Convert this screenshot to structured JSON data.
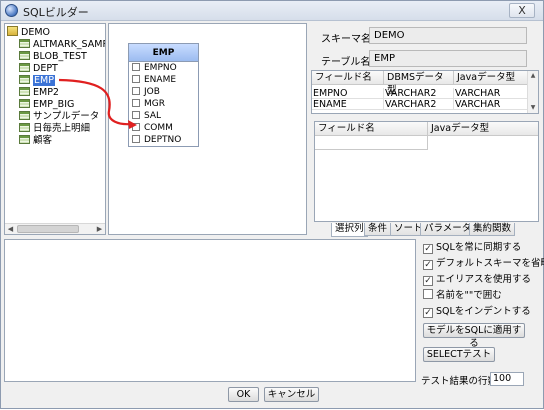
{
  "window": {
    "title": "SQLビルダー",
    "close_label": "X"
  },
  "tree": {
    "root": "DEMO",
    "items": [
      {
        "label": "ALTMARK_SAMPL"
      },
      {
        "label": "BLOB_TEST"
      },
      {
        "label": "DEPT"
      },
      {
        "label": "EMP",
        "selected": true
      },
      {
        "label": "EMP2"
      },
      {
        "label": "EMP_BIG"
      },
      {
        "label": "サンプルデータ"
      },
      {
        "label": "日毎売上明細"
      },
      {
        "label": "顧客"
      }
    ]
  },
  "diagram": {
    "entity": {
      "name": "EMP",
      "fields": [
        "EMPNO",
        "ENAME",
        "JOB",
        "MGR",
        "SAL",
        "COMM",
        "DEPTNO"
      ]
    }
  },
  "info": {
    "schema_label": "スキーマ名",
    "schema_value": "DEMO",
    "table_label": "テーブル名",
    "table_value": "EMP"
  },
  "field_grid": {
    "headers": [
      "フィールド名",
      "DBMSデータ型",
      "Javaデータ型"
    ],
    "rows": [
      [
        "EMPNO",
        "VARCHAR2",
        "VARCHAR"
      ],
      [
        "ENAME",
        "VARCHAR2",
        "VARCHAR"
      ]
    ]
  },
  "selected_grid": {
    "headers": [
      "フィールド名",
      "Javaデータ型"
    ]
  },
  "tabs": [
    "選択列",
    "条件",
    "ソート",
    "パラメーター",
    "集約関数"
  ],
  "options": {
    "checkboxes": [
      {
        "label": "SQLを常に同期する",
        "checked": true
      },
      {
        "label": "デフォルトスキーマを省略する",
        "checked": true
      },
      {
        "label": "エイリアスを使用する",
        "checked": true
      },
      {
        "label": "名前を\"\"で囲む",
        "checked": false
      },
      {
        "label": "SQLをインデントする",
        "checked": true
      }
    ],
    "apply_button": "モデルをSQLに適用する",
    "test_button": "SELECTテスト",
    "rows_label": "テスト結果の行数",
    "rows_value": "100"
  },
  "footer": {
    "ok": "OK",
    "cancel": "キャンセル"
  },
  "colors": {
    "selection": "#3b73d6",
    "arrow": "#e02020",
    "entity_header": "#9cbcf0"
  }
}
